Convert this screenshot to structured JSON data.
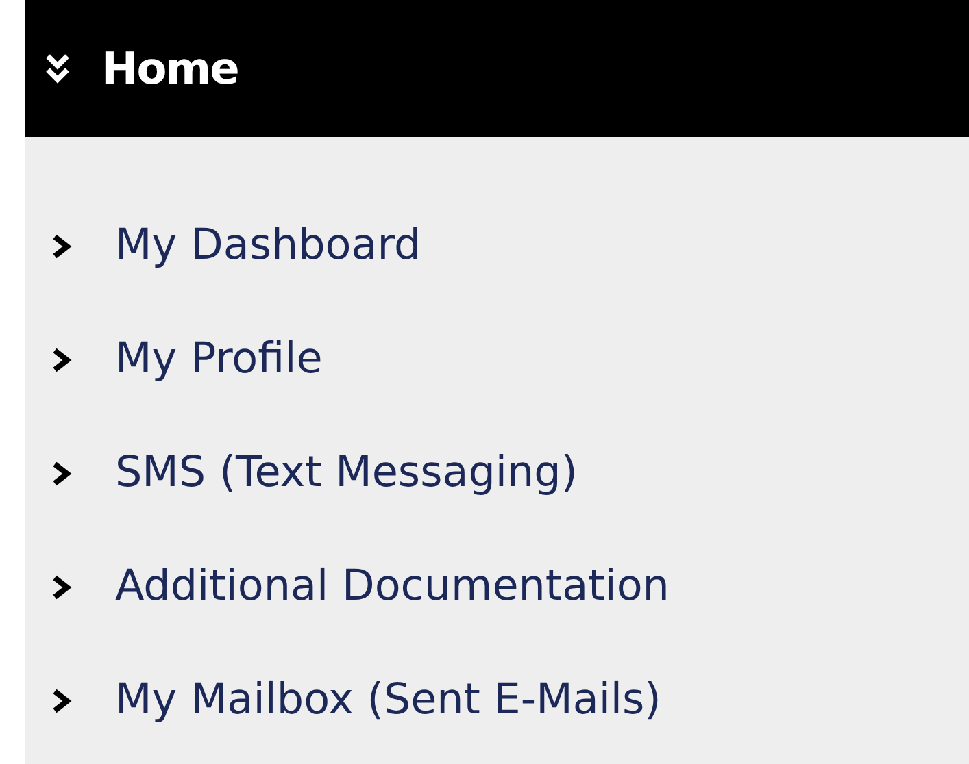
{
  "menu": {
    "title": "Home",
    "expanded": true,
    "items": [
      {
        "label": "My Dashboard"
      },
      {
        "label": "My Profile"
      },
      {
        "label": "SMS (Text Messaging)"
      },
      {
        "label": "Additional Documentation"
      },
      {
        "label": "My Mailbox (Sent E-Mails)"
      }
    ]
  }
}
